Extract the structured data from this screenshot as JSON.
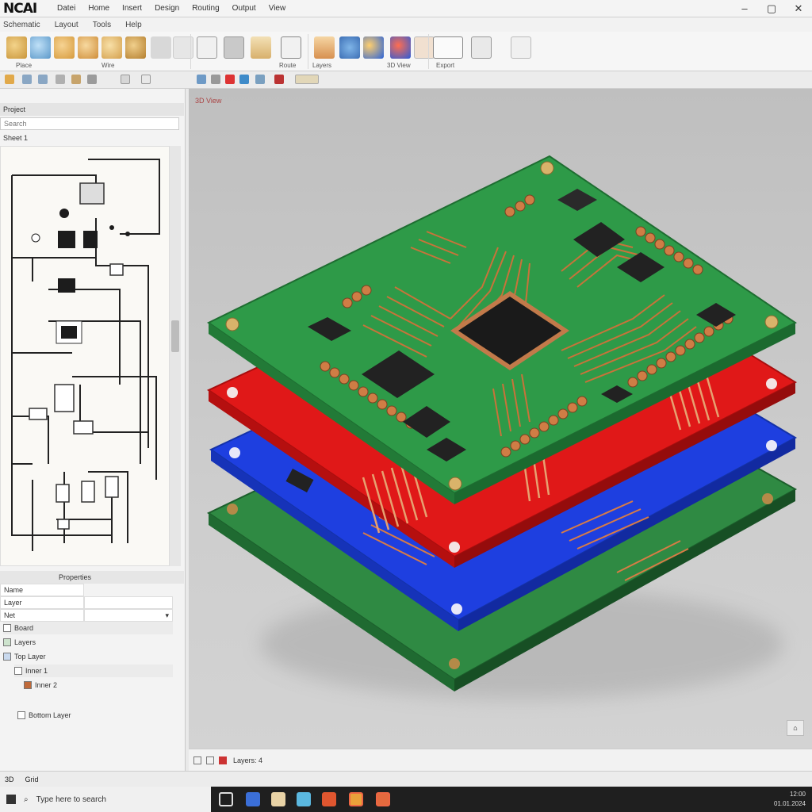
{
  "app": {
    "logo_text": "NCAI",
    "menu": [
      "Datei",
      "Home",
      "Insert",
      "Design",
      "Routing",
      "Output",
      "View"
    ],
    "window_controls": [
      "–",
      "▢",
      "✕"
    ]
  },
  "ribbon": {
    "tabs": [
      "Schematic",
      "Layout",
      "Tools",
      "Help"
    ],
    "group_labels": [
      "Place",
      "Wire",
      "Route",
      "Layers",
      "3D View",
      "Export"
    ]
  },
  "left_panel": {
    "header": "Project",
    "search_placeholder": "Search",
    "section_label": "Sheet 1",
    "properties_header": "Properties",
    "properties_rows": [
      {
        "label": "Name",
        "value": ""
      },
      {
        "label": "Layer",
        "value": ""
      },
      {
        "label": "Net",
        "value": ""
      }
    ],
    "tree_items": [
      "Board",
      "Layers",
      "Top Layer",
      "Inner 1",
      "Inner 2",
      "Bottom Layer"
    ],
    "status_items": [
      "3D",
      "Grid"
    ]
  },
  "viewport": {
    "label": "3D View",
    "corner_button": "⌂",
    "status_text": "Layers: 4"
  },
  "board": {
    "layers": [
      {
        "name": "Top",
        "color": "#2e9a48"
      },
      {
        "name": "Inner 1",
        "color": "#e01818"
      },
      {
        "name": "Inner 2",
        "color": "#1e3fe0"
      },
      {
        "name": "Bottom",
        "color": "#2f8a43"
      }
    ],
    "trace_color": "#c8733a",
    "chip_color": "#222222"
  },
  "taskbar": {
    "search_text": "Type here to search",
    "tray_time": "12:00",
    "tray_date": "01.01.2024"
  }
}
